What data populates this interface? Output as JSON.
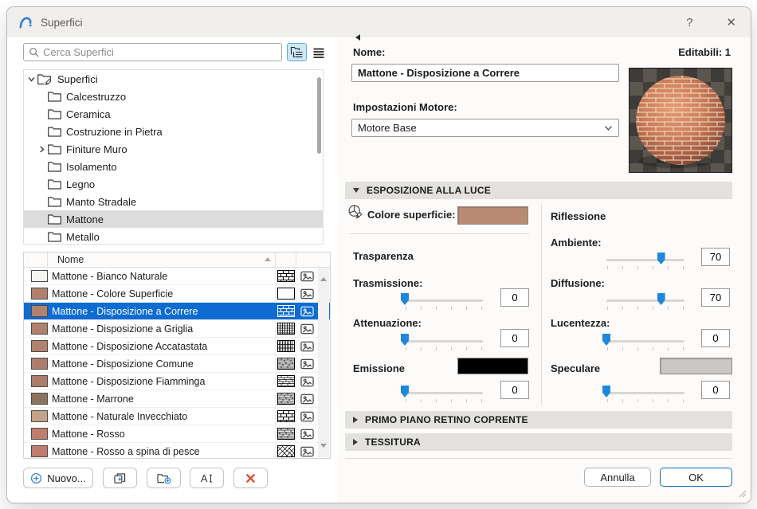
{
  "window": {
    "title": "Superfici",
    "help": "?",
    "close": "✕"
  },
  "left": {
    "search": {
      "placeholder": "Cerca Superfici"
    },
    "tree": {
      "items": [
        {
          "label": "Superfici",
          "root": true,
          "chevron": "down"
        },
        {
          "label": "Calcestruzzo",
          "child": true
        },
        {
          "label": "Ceramica",
          "child": true
        },
        {
          "label": "Costruzione in Pietra",
          "child": true
        },
        {
          "label": "Finiture Muro",
          "child": true,
          "chevron": "right"
        },
        {
          "label": "Isolamento",
          "child": true
        },
        {
          "label": "Legno",
          "child": true
        },
        {
          "label": "Manto Stradale",
          "child": true
        },
        {
          "label": "Mattone",
          "child": true,
          "selected": true
        },
        {
          "label": "Metallo",
          "child": true
        }
      ]
    },
    "list": {
      "header": "Nome",
      "rows": [
        {
          "name": "Mattone - Bianco Naturale",
          "swatch": "#f7f5f2",
          "pattern": "brick"
        },
        {
          "name": "Mattone - Colore Superficie",
          "swatch": "#b1816d",
          "pattern": "plain"
        },
        {
          "name": "Mattone - Disposizione a Correre",
          "swatch": "#b1816d",
          "pattern": "brick",
          "selected": true
        },
        {
          "name": "Mattone - Disposizione a Griglia",
          "swatch": "#b1816d",
          "pattern": "grid"
        },
        {
          "name": "Mattone - Disposizione Accatastata",
          "swatch": "#b1816d",
          "pattern": "vlines"
        },
        {
          "name": "Mattone - Disposizione Comune",
          "swatch": "#ad7d6b",
          "pattern": "dense"
        },
        {
          "name": "Mattone - Disposizione Fiamminga",
          "swatch": "#ad7d6b",
          "pattern": "dense"
        },
        {
          "name": "Mattone - Marrone",
          "swatch": "#8c7260",
          "pattern": "dense"
        },
        {
          "name": "Mattone - Naturale Invecchiato",
          "swatch": "#c2a189",
          "pattern": "brick"
        },
        {
          "name": "Mattone - Rosso",
          "swatch": "#c07c6c",
          "pattern": "dense"
        },
        {
          "name": "Mattone - Rosso a spina di pesce",
          "swatch": "#c07c6c",
          "pattern": "herringbone"
        }
      ]
    },
    "toolbar": {
      "new_label": "Nuovo..."
    }
  },
  "right": {
    "name_label": "Nome:",
    "editable_count": "Editabili: 1",
    "name_value": "Mattone - Disposizione a Correre",
    "engine_label": "Impostazioni Motore:",
    "engine_value": "Motore Base",
    "exposure": {
      "title": "ESPOSIZIONE ALLA LUCE",
      "surface_color_label": "Colore superficie:",
      "surface_color": "#b98a74",
      "transparency_title": "Trasparenza",
      "reflection_title": "Riflessione",
      "sliders": {
        "trasmissione": {
          "label": "Trasmissione:",
          "value": 0
        },
        "attenuazione": {
          "label": "Attenuazione:",
          "value": 0
        },
        "emissione": {
          "label": "Emissione",
          "value": 0,
          "color": "#000000"
        },
        "ambiente": {
          "label": "Ambiente:",
          "value": 70
        },
        "diffusione": {
          "label": "Diffusione:",
          "value": 70
        },
        "lucentezza": {
          "label": "Lucentezza:",
          "value": 0
        },
        "speculare": {
          "label": "Speculare",
          "value": 0,
          "color": "#cac8c5"
        }
      }
    },
    "sections": {
      "foreground": "PRIMO PIANO RETINO COPRENTE",
      "texture": "TESSITURA"
    },
    "footer": {
      "cancel": "Annulla",
      "ok": "OK"
    }
  }
}
